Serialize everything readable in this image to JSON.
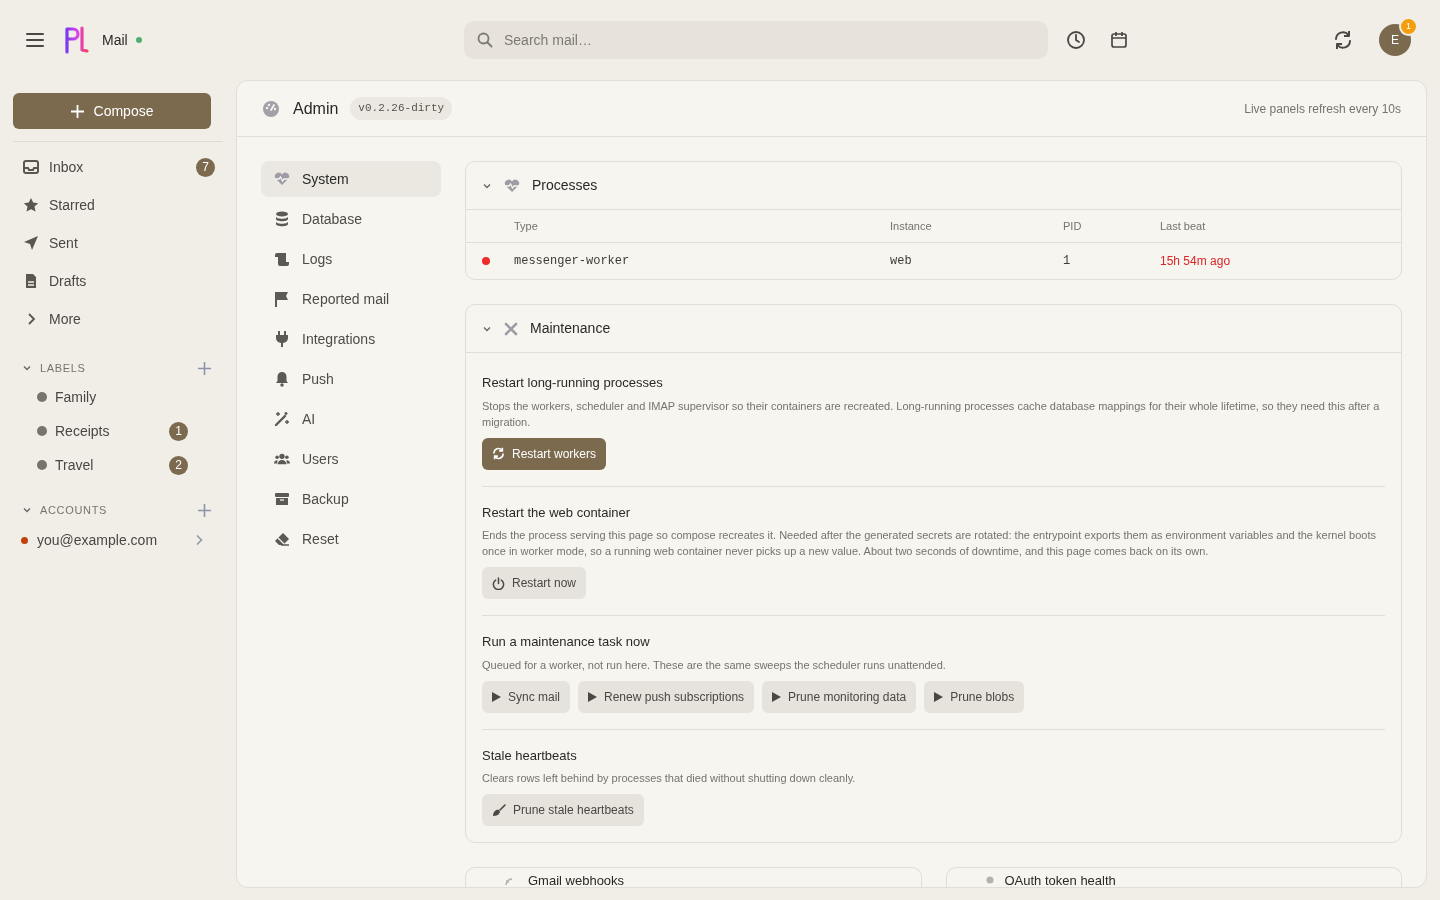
{
  "app": {
    "name": "Mail",
    "online": true
  },
  "search": {
    "placeholder": "Search mail…"
  },
  "avatar": {
    "initial": "E",
    "badge": "1"
  },
  "compose": "Compose",
  "nav": [
    {
      "label": "Inbox",
      "count": "7"
    },
    {
      "label": "Starred"
    },
    {
      "label": "Sent"
    },
    {
      "label": "Drafts"
    },
    {
      "label": "More"
    }
  ],
  "labels": {
    "title": "LABELS",
    "expanded": true,
    "items": [
      {
        "name": "Family"
      },
      {
        "name": "Receipts",
        "count": "1"
      },
      {
        "name": "Travel",
        "count": "2"
      }
    ]
  },
  "accounts": {
    "title": "ACCOUNTS",
    "expanded": true,
    "items": [
      {
        "email": "you@example.com",
        "color": "#c2410c"
      }
    ]
  },
  "admin": {
    "title": "Admin",
    "version": "v0.2.26-dirty",
    "note": "Live panels refresh every 10s"
  },
  "admin_nav": [
    {
      "label": "System",
      "selected": true
    },
    {
      "label": "Database",
      "selected": false
    },
    {
      "label": "Logs",
      "selected": false
    },
    {
      "label": "Reported mail",
      "selected": false
    },
    {
      "label": "Integrations",
      "selected": false
    },
    {
      "label": "Push",
      "selected": false
    },
    {
      "label": "AI",
      "selected": false
    },
    {
      "label": "Users",
      "selected": false
    },
    {
      "label": "Backup",
      "selected": false
    },
    {
      "label": "Reset",
      "selected": false
    }
  ],
  "processes": {
    "title": "Processes",
    "expanded": true,
    "columns": [
      "Type",
      "Instance",
      "PID",
      "Last beat"
    ],
    "rows": [
      {
        "color": "#ef2b2b",
        "type": "messenger-worker",
        "instance": "web",
        "pid": "1",
        "last_beat": "15h 54m ago",
        "stale": true
      }
    ]
  },
  "maintenance": {
    "title": "Maintenance",
    "expanded": true,
    "sections": [
      {
        "title": "Restart long-running processes",
        "text": "Stops the workers, scheduler and IMAP supervisor so their containers are recreated. Long-running processes cache database mappings for their whole lifetime, so they need this after a migration.",
        "buttons": [
          {
            "label": "Restart workers",
            "primary": true
          }
        ]
      },
      {
        "title": "Restart the web container",
        "text": "Ends the process serving this page so compose recreates it. Needed after the generated secrets are rotated: the entrypoint exports them as environment variables and the kernel boots once in worker mode, so a running web container never picks up a new value. About two seconds of downtime, and this page comes back on its own.",
        "buttons": [
          {
            "label": "Restart now",
            "primary": false
          }
        ]
      },
      {
        "title": "Run a maintenance task now",
        "text": "Queued for a worker, not run here. These are the same sweeps the scheduler runs unattended.",
        "buttons": [
          {
            "label": "Sync mail",
            "primary": false
          },
          {
            "label": "Renew push subscriptions",
            "primary": false
          },
          {
            "label": "Prune monitoring data",
            "primary": false
          },
          {
            "label": "Prune blobs",
            "primary": false
          }
        ]
      },
      {
        "title": "Stale heartbeats",
        "text": "Clears rows left behind by processes that died without shutting down cleanly.",
        "buttons": [
          {
            "label": "Prune stale heartbeats",
            "primary": false
          }
        ]
      }
    ]
  },
  "bottom_cards": [
    {
      "title": "Gmail webhooks"
    },
    {
      "title": "OAuth token health"
    }
  ]
}
